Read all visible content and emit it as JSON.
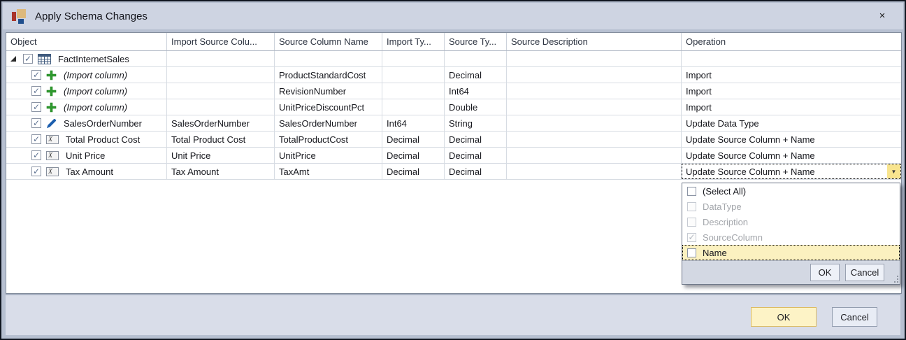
{
  "window": {
    "title": "Apply Schema Changes",
    "close_glyph": "×"
  },
  "grid": {
    "columns": [
      "Object",
      "Import Source Colu...",
      "Source Column Name",
      "Import Ty...",
      "Source Ty...",
      "Source Description",
      "Operation"
    ],
    "parent_row": {
      "label": "FactInternetSales",
      "checked": true,
      "expanded": true
    },
    "rows": [
      {
        "object": "(Import column)",
        "import_source_column": "",
        "source_column_name": "ProductStandardCost",
        "import_type": "",
        "source_type": "Decimal",
        "source_description": "",
        "operation": "Import"
      },
      {
        "object": "(Import column)",
        "import_source_column": "",
        "source_column_name": "RevisionNumber",
        "import_type": "",
        "source_type": "Int64",
        "source_description": "",
        "operation": "Import"
      },
      {
        "object": "(Import column)",
        "import_source_column": "",
        "source_column_name": "UnitPriceDiscountPct",
        "import_type": "",
        "source_type": "Double",
        "source_description": "",
        "operation": "Import"
      },
      {
        "object": "SalesOrderNumber",
        "import_source_column": "SalesOrderNumber",
        "source_column_name": "SalesOrderNumber",
        "import_type": "Int64",
        "source_type": "String",
        "source_description": "",
        "operation": "Update Data Type"
      },
      {
        "object": "Total Product Cost",
        "import_source_column": "Total Product Cost",
        "source_column_name": "TotalProductCost",
        "import_type": "Decimal",
        "source_type": "Decimal",
        "source_description": "",
        "operation": "Update Source Column + Name"
      },
      {
        "object": "Unit Price",
        "import_source_column": "Unit Price",
        "source_column_name": "UnitPrice",
        "import_type": "Decimal",
        "source_type": "Decimal",
        "source_description": "",
        "operation": "Update Source Column + Name"
      },
      {
        "object": "Tax Amount",
        "import_source_column": "Tax Amount",
        "source_column_name": "TaxAmt",
        "import_type": "Decimal",
        "source_type": "Decimal",
        "source_description": "",
        "operation": "Update Source Column + Name"
      }
    ]
  },
  "operation_dropdown": {
    "anchor_row": "Tax Amount",
    "items": [
      {
        "label": "(Select All)",
        "checked": false,
        "disabled": false,
        "highlighted": false
      },
      {
        "label": "DataType",
        "checked": false,
        "disabled": true,
        "highlighted": false
      },
      {
        "label": "Description",
        "checked": false,
        "disabled": true,
        "highlighted": false
      },
      {
        "label": "SourceColumn",
        "checked": true,
        "disabled": true,
        "highlighted": false
      },
      {
        "label": "Name",
        "checked": false,
        "disabled": false,
        "highlighted": true
      }
    ],
    "ok_label": "OK",
    "cancel_label": "Cancel"
  },
  "footer": {
    "ok_label": "OK",
    "cancel_label": "Cancel"
  },
  "colors": {
    "titlebar_bg": "#ced4e2",
    "focused_button_bg": "#fdf3c6",
    "highlight_row_bg": "#fbf1c0",
    "combo_arrow_bg": "#f8e48e",
    "add_icon_green": "#2e9b2e",
    "edit_icon_blue": "#1d5fae",
    "table_icon_blue": "#3f5a7d"
  }
}
